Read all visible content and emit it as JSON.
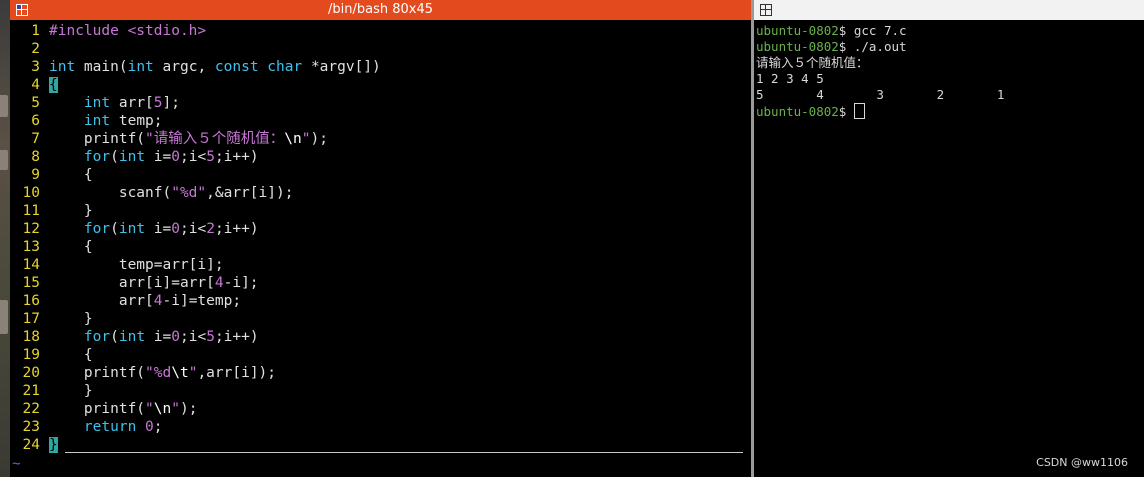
{
  "left_window": {
    "title": "/bin/bash 80x45",
    "tilde": "~"
  },
  "code_lines": [
    {
      "n": "1",
      "html": "<span class=\"pp\">#include</span> <span class=\"hdr\">&lt;stdio.h&gt;</span>"
    },
    {
      "n": "2",
      "html": ""
    },
    {
      "n": "3",
      "html": "<span class=\"kw\">int</span> main(<span class=\"kw\">int</span> argc, <span class=\"kw\">const</span> <span class=\"kw\">char</span> *argv[])"
    },
    {
      "n": "4",
      "html": "<span class=\"cursor-block\">{</span>"
    },
    {
      "n": "5",
      "html": "    <span class=\"kw\">int</span> arr[<span class=\"num\">5</span>];"
    },
    {
      "n": "6",
      "html": "    <span class=\"kw\">int</span> temp;"
    },
    {
      "n": "7",
      "html": "    printf(<span class=\"str\">\"请输入５个随机值：</span><span class=\"esc\">\\n</span><span class=\"str\">\"</span>);"
    },
    {
      "n": "8",
      "html": "    <span class=\"kw\">for</span>(<span class=\"kw\">int</span> i=<span class=\"num\">0</span>;i&lt;<span class=\"num\">5</span>;i++)"
    },
    {
      "n": "9",
      "html": "    {"
    },
    {
      "n": "10",
      "html": "        scanf(<span class=\"str\">\"%d\"</span>,&amp;arr[i]);"
    },
    {
      "n": "11",
      "html": "    }"
    },
    {
      "n": "12",
      "html": "    <span class=\"kw\">for</span>(<span class=\"kw\">int</span> i=<span class=\"num\">0</span>;i&lt;<span class=\"num\">2</span>;i++)"
    },
    {
      "n": "13",
      "html": "    {"
    },
    {
      "n": "14",
      "html": "        temp=arr[i];"
    },
    {
      "n": "15",
      "html": "        arr[i]=arr[<span class=\"num\">4</span>-i];"
    },
    {
      "n": "16",
      "html": "        arr[<span class=\"num\">4</span>-i]=temp;"
    },
    {
      "n": "17",
      "html": "    }"
    },
    {
      "n": "18",
      "html": "    <span class=\"kw\">for</span>(<span class=\"kw\">int</span> i=<span class=\"num\">0</span>;i&lt;<span class=\"num\">5</span>;i++)"
    },
    {
      "n": "19",
      "html": "    {"
    },
    {
      "n": "20",
      "html": "    printf(<span class=\"str\">\"%d</span><span class=\"esc\">\\t</span><span class=\"str\">\"</span>,arr[i]);"
    },
    {
      "n": "21",
      "html": "    }"
    },
    {
      "n": "22",
      "html": "    printf(<span class=\"str\">\"</span><span class=\"esc\">\\n</span><span class=\"str\">\"</span>);"
    },
    {
      "n": "23",
      "html": "    <span class=\"kw\">return</span> <span class=\"num\">0</span>;"
    },
    {
      "n": "24",
      "html": "<span class=\"cursor-block\">}</span>"
    }
  ],
  "terminal": {
    "lines": [
      {
        "host": "ubuntu-0802",
        "rest": "$ gcc 7.c"
      },
      {
        "host": "ubuntu-0802",
        "rest": "$ ./a.out"
      },
      {
        "host": "",
        "rest": "请输入５个随机值："
      },
      {
        "host": "",
        "rest": "1 2 3 4 5"
      },
      {
        "host": "",
        "rest": "5       4       3       2       1"
      },
      {
        "host": "ubuntu-0802",
        "rest": "$ ",
        "cursor": true
      }
    ]
  },
  "watermark": "CSDN @ww1106"
}
